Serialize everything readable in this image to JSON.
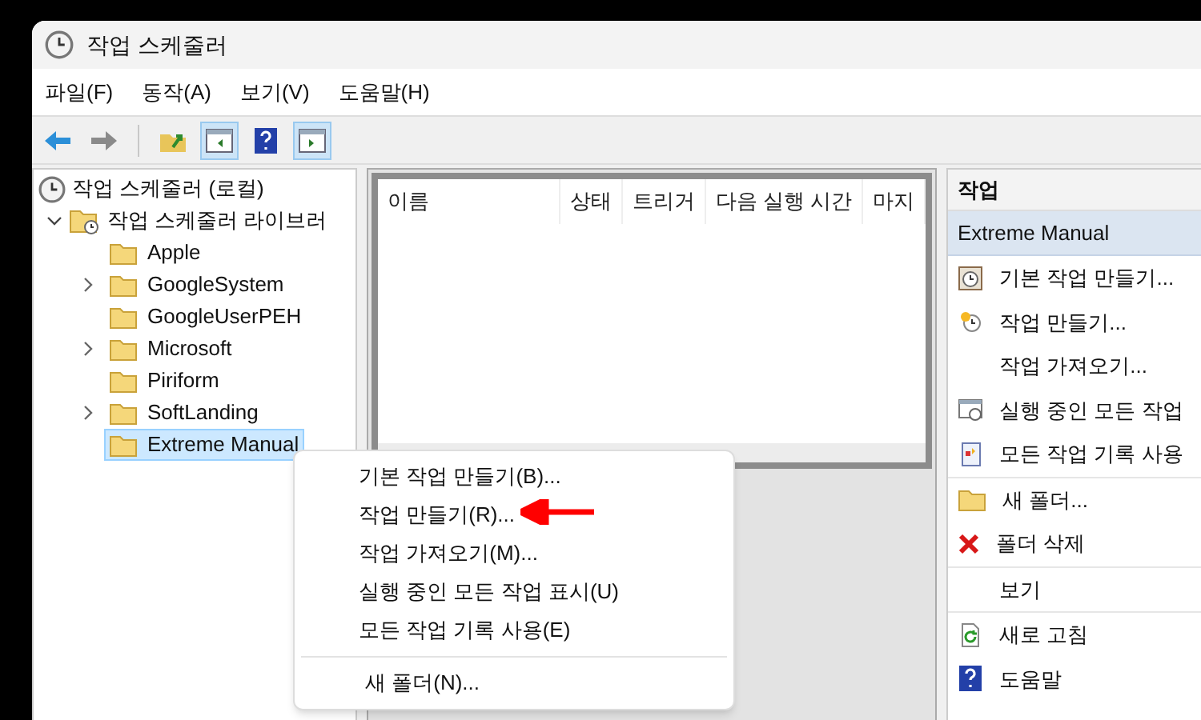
{
  "window": {
    "title": "작업 스케줄러"
  },
  "menu_bar": [
    "파일(F)",
    "동작(A)",
    "보기(V)",
    "도움말(H)"
  ],
  "toolbar": [
    {
      "kind": "back",
      "pressed": false
    },
    {
      "kind": "forward",
      "pressed": false
    },
    {
      "kind": "up",
      "pressed": false
    },
    {
      "kind": "tree-pane",
      "pressed": true
    },
    {
      "kind": "help",
      "pressed": false
    },
    {
      "kind": "action-pane",
      "pressed": true
    }
  ],
  "tree": {
    "label": "작업 스케줄러 (로컬)",
    "children": [
      {
        "label": "작업 스케줄러 라이브러",
        "expanded": true,
        "children": [
          {
            "label": "Apple",
            "expandable": false,
            "selected": false
          },
          {
            "label": "GoogleSystem",
            "expandable": true,
            "selected": false
          },
          {
            "label": "GoogleUserPEH",
            "expandable": false,
            "selected": false
          },
          {
            "label": "Microsoft",
            "expandable": true,
            "selected": false
          },
          {
            "label": "Piriform",
            "expandable": false,
            "selected": false
          },
          {
            "label": "SoftLanding",
            "expandable": true,
            "selected": false
          },
          {
            "label": "Extreme Manual",
            "expandable": false,
            "selected": true
          }
        ]
      }
    ]
  },
  "table": {
    "columns": [
      "이름",
      "상태",
      "트리거",
      "다음 실행 시간",
      "마지"
    ]
  },
  "actions_pane": {
    "title": "작업",
    "section": "Extreme Manual",
    "groups": [
      [
        {
          "label": "기본 작업 만들기...",
          "kind": "clock-card"
        },
        {
          "label": "작업 만들기...",
          "kind": "clock-star"
        },
        {
          "label": "작업 가져오기...",
          "kind": "plain"
        },
        {
          "label": "실행 중인 모든 작업",
          "kind": "window-clock"
        },
        {
          "label": "모든 작업 기록 사용",
          "kind": "notebook"
        }
      ],
      [
        {
          "label": "새 폴더...",
          "kind": "folder"
        },
        {
          "label": "폴더 삭제",
          "kind": "x"
        }
      ],
      [
        {
          "label": "보기",
          "kind": "plain"
        }
      ],
      [
        {
          "label": "새로 고침",
          "kind": "refresh"
        },
        {
          "label": "도움말",
          "kind": "help"
        }
      ]
    ]
  },
  "context_menu": {
    "groups": [
      [
        "기본 작업 만들기(B)...",
        "작업 만들기(R)...",
        "작업 가져오기(M)...",
        "실행 중인 모든 작업 표시(U)",
        "모든 작업 기록 사용(E)"
      ],
      [
        "새 폴더(N)..."
      ]
    ]
  }
}
